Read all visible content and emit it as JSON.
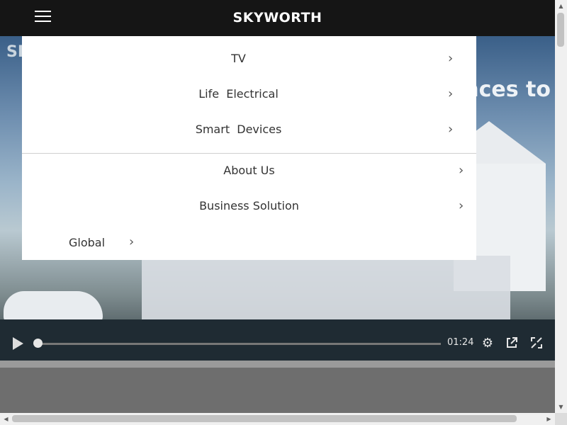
{
  "header": {
    "logo": "SKYWORTH",
    "menu_icon": "hamburger-icon"
  },
  "hero": {
    "bg_text_left": "SK",
    "bg_text_right": "nces to"
  },
  "menu": {
    "items": [
      {
        "label": "TV"
      },
      {
        "label": "Life  Electrical"
      },
      {
        "label": "Smart  Devices"
      },
      {
        "label": "About Us"
      },
      {
        "label": "Business Solution"
      }
    ],
    "global_label": "Global"
  },
  "player": {
    "time": "01:24",
    "progress": 0.0,
    "icons": [
      "play-icon",
      "gear-icon",
      "external-link-icon",
      "fullscreen-icon"
    ]
  },
  "colors": {
    "header_bg": "#151515",
    "menu_bg": "#ffffff",
    "page_bg": "#6e6e6e"
  }
}
